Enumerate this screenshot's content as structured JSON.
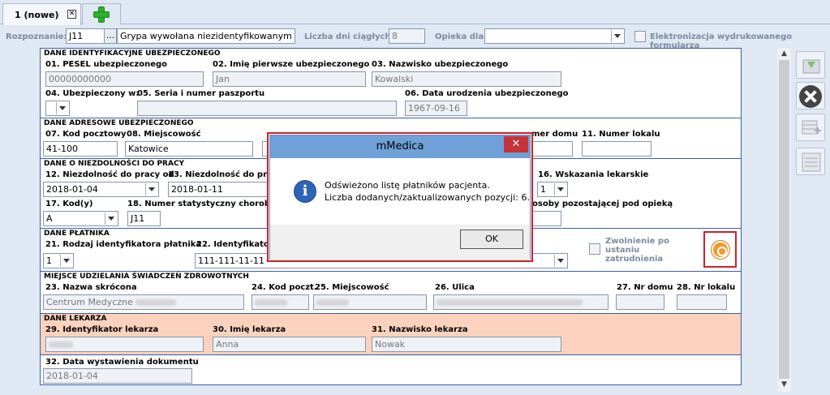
{
  "tabs": {
    "active_label": "1 (nowe)",
    "close_glyph": "✕"
  },
  "topbar": {
    "rozpoznanie_label": "Rozpoznanie:",
    "rozpoznanie_code": "J11",
    "rozpoznanie_btn": "...",
    "rozpoznanie_desc": "Grypa wywołana niezidentyfikowanym ...",
    "dni_label": "Liczba dni ciągłych:",
    "dni_value": "8",
    "opieka_label": "Opieka dla:",
    "opieka_value": "",
    "elektronizacja_label": "Elektronizacja wydrukowanego formularza"
  },
  "insured": {
    "title": "DANE IDENTYFIKACYJNE UBEZPIECZONEGO",
    "pesel_label": "01. PESEL ubezpieczonego",
    "pesel_value": "00000000000",
    "imie_label": "02. Imię pierwsze ubezpieczonego",
    "imie_value": "Jan",
    "nazwisko_label": "03. Nazwisko ubezpieczonego",
    "nazwisko_value": "Kowalski",
    "ubezp_label": "04. Ubezpieczony w:",
    "paszport_label": "05. Seria i numer paszportu",
    "data_ur_label": "06. Data urodzenia ubezpieczonego",
    "data_ur_value": "1967-09-16"
  },
  "address": {
    "title": "DANE ADRESOWE UBEZPIECZONEGO",
    "kod_label": "07. Kod pocztowy",
    "kod_value": "41-100",
    "miejsc_label": "08. Miejscowość",
    "miejsc_value": "Katowice",
    "dom_label": "mer domu",
    "lokal_label": "11. Numer lokalu"
  },
  "incapacity": {
    "title": "DANE O NIEZDOLNOŚCI DO PRACY",
    "od_label": "12. Niezdolność do pracy od",
    "od_value": "2018-01-04",
    "do_label": "13. Niezdolność do prac",
    "do_value": "2018-01-11",
    "wskazania_label": "16. Wskazania lekarskie",
    "wskazania_value": "1",
    "kod_label": "17. Kod(y)",
    "kod_value": "A",
    "stat_label": "18. Numer statystyczny choroby",
    "stat_value": "J11",
    "opieka_label": "osoby pozostającej pod opieką"
  },
  "payer": {
    "title": "DANE PŁATNIKA",
    "rodzaj_label": "21. Rodzaj identyfikatora płatnika",
    "rodzaj_value": "1",
    "ident_label": "22. Identyfikator",
    "ident_value": "111-111-11-11",
    "zwolnienie_label": "Zwolnienie po ustaniu zatrudnienia"
  },
  "facility": {
    "title": "MIEJSCE UDZIELANIA ŚWIADCZEŃ ZDROWOTNYCH",
    "nazwa_label": "23. Nazwa skrócona",
    "nazwa_value": "Centrum Medyczne",
    "kod_label": "24. Kod poczt.",
    "miejsc_label": "25. Miejscowość",
    "ulica_label": "26. Ulica",
    "dom_label": "27. Nr domu",
    "lokal_label": "28. Nr lokalu"
  },
  "doctor": {
    "title": "DANE LEKARZA",
    "id_label": "29. Identyfikator lekarza",
    "imie_label": "30. Imię lekarza",
    "imie_value": "Anna",
    "nazwisko_label": "31. Nazwisko lekarza",
    "nazwisko_value": "Nowak"
  },
  "issue": {
    "label": "32. Data wystawienia dokumentu",
    "value": "2018-01-04"
  },
  "modal": {
    "title": "mMedica",
    "close": "✕",
    "icon": "i",
    "line1": "Odświeżono listę płatników pacjenta.",
    "line2": "Liczba dodanych/zaktualizowanych pozycji: 6.",
    "ok": "OK"
  },
  "colors": {
    "accent": "#3b5fa3",
    "doctor_bg": "#fad2bd",
    "modal_title": "#6fa0d8",
    "alert": "#d0202a"
  }
}
